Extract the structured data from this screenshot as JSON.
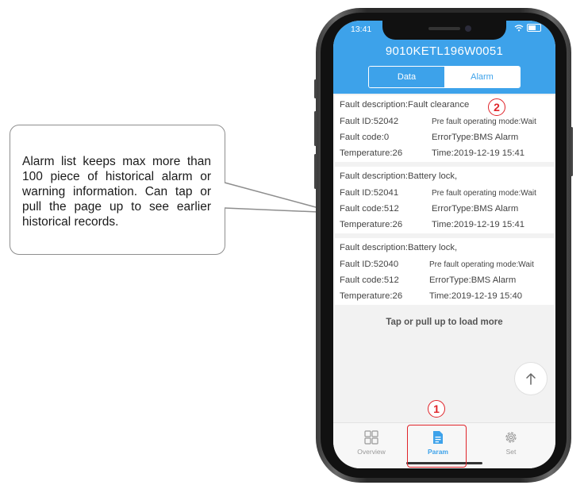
{
  "callout": {
    "text": "Alarm list keeps max more than 100 piece of historical alarm or warning information. Can tap or pull the page up to see earlier historical records."
  },
  "status_bar": {
    "time": "13:41"
  },
  "header": {
    "device_id": "9010KETL196W0051",
    "tabs": [
      {
        "label": "Data",
        "selected": false
      },
      {
        "label": "Alarm",
        "selected": true
      }
    ]
  },
  "alarms": [
    {
      "fault_description": "Fault description:Fault clearance",
      "fault_id": "Fault ID:52042",
      "pre_fault_mode": "Pre fault operating mode:Wait",
      "fault_code": "Fault code:0",
      "error_type": "ErrorType:BMS Alarm",
      "temperature": "Temperature:26",
      "time": "Time:2019-12-19 15:41"
    },
    {
      "fault_description": "Fault description:Battery lock,",
      "fault_id": "Fault ID:52041",
      "pre_fault_mode": "Pre fault operating mode:Wait",
      "fault_code": "Fault code:512",
      "error_type": "ErrorType:BMS Alarm",
      "temperature": "Temperature:26",
      "time": "Time:2019-12-19 15:41"
    },
    {
      "fault_description": "Fault description:Battery lock,",
      "fault_id": "Fault ID:52040",
      "pre_fault_mode": "Pre fault operating mode:Wait",
      "fault_code": "Fault code:512",
      "error_type": "ErrorType:BMS Alarm",
      "temperature": "Temperature:26",
      "time": "Time:2019-12-19 15:40"
    }
  ],
  "load_more": "Tap or pull up to load more",
  "bottom_nav": [
    {
      "label": "Overview",
      "icon": "grid-icon",
      "active": false
    },
    {
      "label": "Param",
      "icon": "document-icon",
      "active": true
    },
    {
      "label": "Set",
      "icon": "gear-icon",
      "active": false
    }
  ],
  "annotations": {
    "marker_1": "1",
    "marker_2": "2"
  },
  "colors": {
    "header_blue": "#3da2ea",
    "marker_red": "#e0242a"
  }
}
